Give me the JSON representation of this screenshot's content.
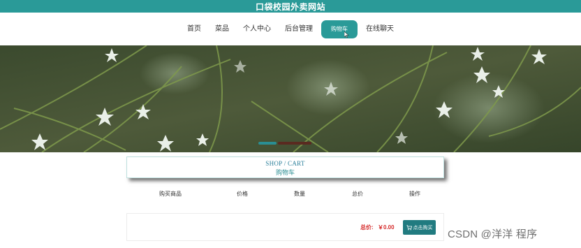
{
  "header": {
    "site_title": "口袋校园外卖网站"
  },
  "nav": {
    "items": [
      {
        "label": "首页",
        "active": false
      },
      {
        "label": "菜品",
        "active": false
      },
      {
        "label": "个人中心",
        "active": false
      },
      {
        "label": "后台管理",
        "active": false
      },
      {
        "label": "购物车",
        "active": true
      },
      {
        "label": "在线聊天",
        "active": false
      }
    ]
  },
  "banner": {
    "image": "grass-and-white-flowers",
    "slides_active": 1,
    "slides_total": 2
  },
  "cart": {
    "heading_en": "SHOP / CART",
    "heading_cn": "购物车",
    "columns": [
      "购买商品",
      "价格",
      "数量",
      "总价",
      "操作"
    ],
    "total_label": "总价:",
    "total_value": "￥0.00",
    "buy_label": "点击购买",
    "buy_icon": "cart-icon"
  },
  "watermark": "CSDN @洋洋  程序",
  "colors": {
    "primary": "#2a9a98",
    "button": "#217b80",
    "price": "#d52b2b"
  }
}
